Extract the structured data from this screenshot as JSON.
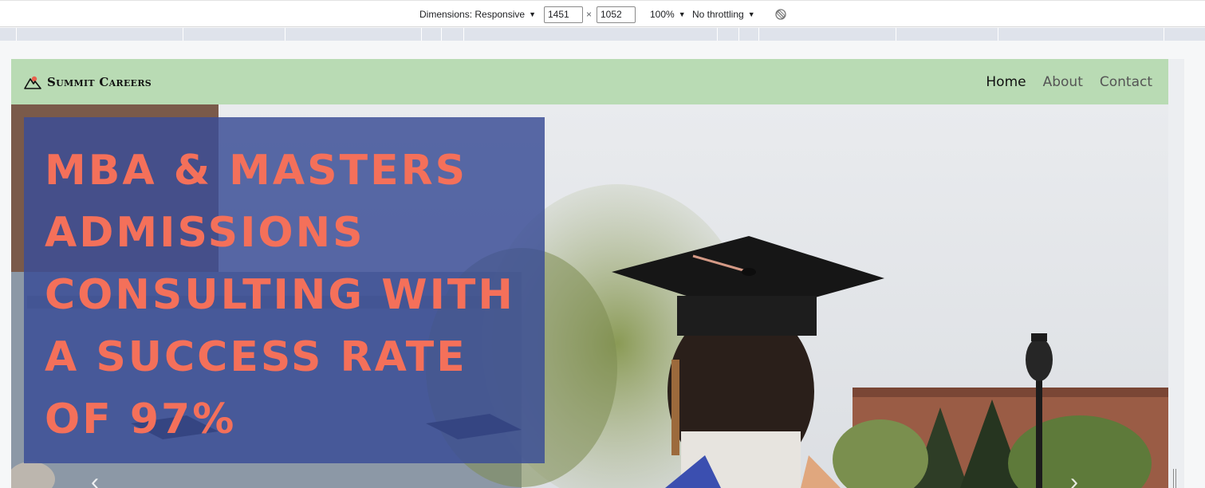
{
  "devtools": {
    "dimensions_label": "Dimensions: Responsive",
    "width_value": "1451",
    "height_value": "1052",
    "times_symbol": "×",
    "zoom_label": "100%",
    "throttling_label": "No throttling",
    "caret": "▼"
  },
  "site": {
    "brand": "Summit Careers",
    "nav": {
      "home": "Home",
      "about": "About",
      "contact": "Contact"
    },
    "hero": {
      "headline": "MBA & MASTERS ADMISSIONS CONSULTING WITH A SUCCESS RATE OF 97%"
    }
  },
  "colors": {
    "navbar_bg": "#b9dbb4",
    "hero_box_bg": "#3a4e96",
    "hero_text": "#f4705a"
  }
}
